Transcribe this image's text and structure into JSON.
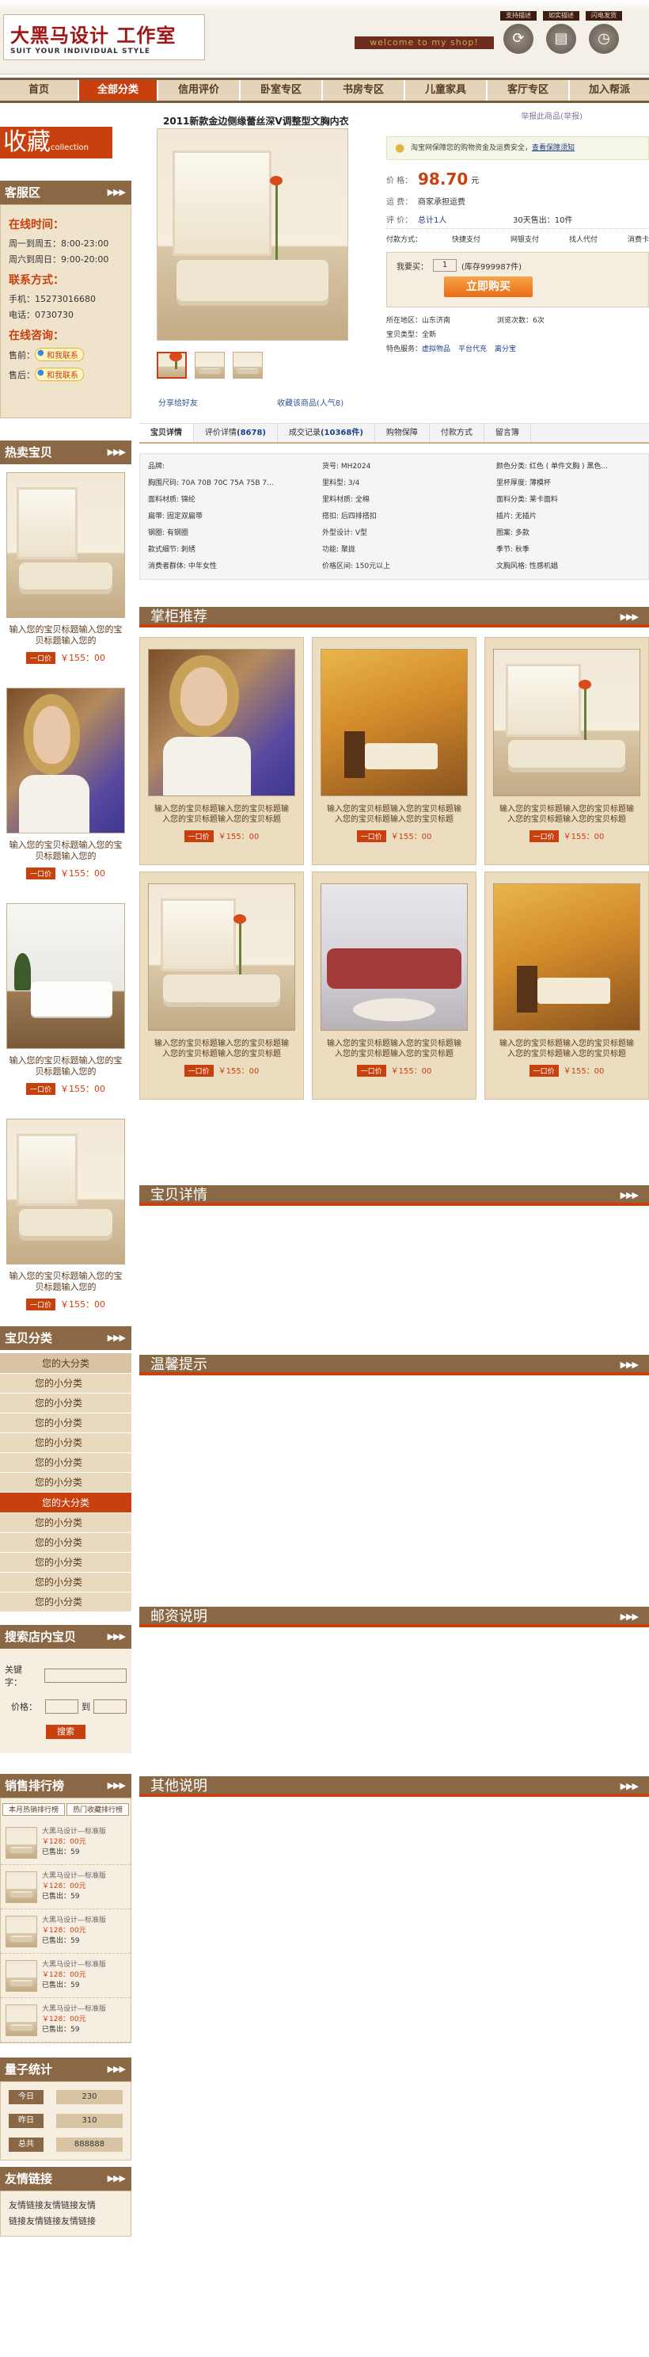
{
  "header": {
    "logo_title": "大黑马设计 工作室",
    "logo_subtitle": "SUIT YOUR INDIVIDUAL STYLE",
    "welcome": "welcome to my shop!",
    "links": [
      {
        "label": "支持描述",
        "icon": "sync-icon"
      },
      {
        "label": "如实描述",
        "icon": "document-icon"
      },
      {
        "label": "闪电发货",
        "icon": "timer-icon"
      }
    ]
  },
  "nav": {
    "items": [
      "首页",
      "全部分类",
      "信用评价",
      "卧室专区",
      "书房专区",
      "儿童家具",
      "客厅专区",
      "加入帮派"
    ],
    "active_index": 1
  },
  "collect": {
    "label": "收藏",
    "sub": "collection"
  },
  "sidebar": {
    "service_title": "客服区",
    "online_time_h": "在线时间：",
    "online_time_1": "周一到周五：8:00-23:00",
    "online_time_2": "周六到周日：9:00-20:00",
    "contact_h": "联系方式：",
    "phone": "手机：15273016680",
    "tel": "电话：0730730",
    "consult_h": "在线咨询：",
    "consult_1_label": "售前：",
    "consult_2_label": "售后：",
    "qq_label": "和我联系",
    "hot_title": "热卖宝贝",
    "hot_items": [
      {
        "name": "输入您的宝贝标题输入您的宝贝标题输入您的",
        "price": "￥155：00",
        "scene": "room"
      },
      {
        "name": "输入您的宝贝标题输入您的宝贝标题输入您的",
        "price": "￥155：00",
        "scene": "woman"
      },
      {
        "name": "输入您的宝贝标题输入您的宝贝标题输入您的",
        "price": "￥155：00",
        "scene": "white"
      },
      {
        "name": "输入您的宝贝标题输入您的宝贝标题输入您的",
        "price": "￥155：00",
        "scene": "room"
      }
    ],
    "buy_tag": "一口价",
    "cat_title": "宝贝分类",
    "categories": [
      {
        "big": "您的大分类",
        "active": false,
        "smalls": [
          "您的小分类",
          "您的小分类",
          "您的小分类",
          "您的小分类",
          "您的小分类",
          "您的小分类"
        ]
      },
      {
        "big": "您的大分类",
        "active": true,
        "smalls": [
          "您的小分类",
          "您的小分类",
          "您的小分类",
          "您的小分类",
          "您的小分类"
        ]
      }
    ],
    "search_title": "搜索店内宝贝",
    "search_keyword_label": "关键字：",
    "search_price_label": "价格：",
    "search_to": "到",
    "search_button": "搜索",
    "rank_title": "销售排行榜",
    "rank_tabs": [
      "本月热销排行榜",
      "热门收藏排行榜"
    ],
    "rank_items": [
      {
        "name": "大黑马设计—标准版",
        "price": "￥128：00元",
        "sold": "已售出：59"
      },
      {
        "name": "大黑马设计—标准版",
        "price": "￥128：00元",
        "sold": "已售出：59"
      },
      {
        "name": "大黑马设计—标准版",
        "price": "￥128：00元",
        "sold": "已售出：59"
      },
      {
        "name": "大黑马设计—标准版",
        "price": "￥128：00元",
        "sold": "已售出：59"
      },
      {
        "name": "大黑马设计—标准版",
        "price": "￥128：00元",
        "sold": "已售出：59"
      }
    ],
    "stats_title": "量子统计",
    "stats": [
      {
        "label": "今日",
        "value": "230"
      },
      {
        "label": "昨日",
        "value": "310"
      },
      {
        "label": "总共",
        "value": "888888"
      }
    ],
    "friends_title": "友情链接",
    "friends_lines": [
      "友情链接友情链接友情",
      "链接友情链接友情链接"
    ]
  },
  "product": {
    "title": "2011新款金边侧缘蕾丝深V调整型文胸内衣",
    "more": "举报此商品(举报)",
    "notice": "淘宝网保障您的购物资金及运费安全，",
    "notice_link": "查看保障须知",
    "price_label": "价    格：",
    "price": "98.70",
    "price_unit": "元",
    "shipping_label": "运    费：",
    "shipping": "商家承担运费",
    "review_label": "评    价：",
    "review_value": "总计1人",
    "sold_30": "30天售出：10件",
    "pay_items": [
      "付款方式：",
      "快捷支付",
      "网银支付",
      "找人代付",
      "消费卡"
    ],
    "qty_label": "我要买：",
    "qty_value": "1",
    "stock": "(库存999987件)",
    "buy_now": "立即购买",
    "location": "所在地区：山东济南",
    "views": "浏览次数：6次",
    "type": "宝贝类型：全新",
    "services_label": "特色服务：",
    "services": [
      "虚拟物品",
      "平台代充",
      "离分宝"
    ],
    "share": "分享给好友",
    "fav": "收藏该商品(人气8)"
  },
  "tabs": [
    {
      "label": "宝贝详情",
      "count": "",
      "active": true
    },
    {
      "label": "评价详情",
      "count": "(8678)",
      "active": false
    },
    {
      "label": "成交记录",
      "count": "(10368件)",
      "active": false
    },
    {
      "label": "购物保障",
      "count": "",
      "active": false
    },
    {
      "label": "付款方式",
      "count": "",
      "active": false
    },
    {
      "label": "留言簿",
      "count": "",
      "active": false
    }
  ],
  "attributes": [
    "品牌:",
    "货号: MH2024",
    "颜色分类: 红色 ( 单件文胸 ) 黑色...",
    "胸围尺码: 70A 70B 70C 75A 75B 7...",
    "里料型: 3/4",
    "里杯厚度: 薄模杯",
    "面料材质: 锦纶",
    "里料材质: 全棉",
    "面料分类: 莱卡面料",
    "扁带: 固定双扁带",
    "搭扣: 后四排搭扣",
    "插片: 无插片",
    "钢圈: 有钢圈",
    "外型设计: V型",
    "图案: 多款",
    "款式细节: 刺绣",
    "功能: 聚拢",
    "季节: 秋季",
    "消费者群体: 中年女性",
    "价格区间: 150元以上",
    "文胸风格: 性感机娼"
  ],
  "sections": {
    "recommend": "掌柜推荐",
    "detail": "宝贝详情",
    "tips": "温馨提示",
    "postage": "邮资说明",
    "other": "其他说明"
  },
  "recommend_items": [
    {
      "name": "输入您的宝贝标题输入您的宝贝标题输入您的宝贝标题输入您的宝贝标题",
      "price": "￥155：00",
      "scene": "woman"
    },
    {
      "name": "输入您的宝贝标题输入您的宝贝标题输入您的宝贝标题输入您的宝贝标题",
      "price": "￥155：00",
      "scene": "dining"
    },
    {
      "name": "输入您的宝贝标题输入您的宝贝标题输入您的宝贝标题输入您的宝贝标题",
      "price": "￥155：00",
      "scene": "room"
    },
    {
      "name": "输入您的宝贝标题输入您的宝贝标题输入您的宝贝标题输入您的宝贝标题",
      "price": "￥155：00",
      "scene": "room"
    },
    {
      "name": "输入您的宝贝标题输入您的宝贝标题输入您的宝贝标题输入您的宝贝标题",
      "price": "￥155：00",
      "scene": "sofa-red"
    },
    {
      "name": "输入您的宝贝标题输入您的宝贝标题输入您的宝贝标题输入您的宝贝标题",
      "price": "￥155：00",
      "scene": "dining"
    }
  ],
  "colors": {
    "brown": "#8a6845",
    "accent": "#c9400f",
    "beige": "#ecdcc0"
  }
}
